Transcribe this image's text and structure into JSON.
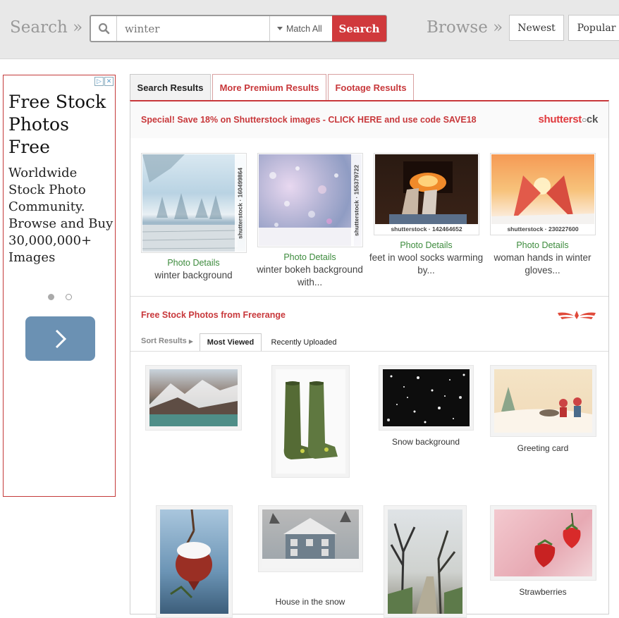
{
  "header": {
    "search_label": "Search »",
    "search_value": "winter",
    "match_label": "Match All",
    "search_button": "Search",
    "browse_label": "Browse »",
    "browse_buttons": [
      "Newest",
      "Popular"
    ]
  },
  "ad": {
    "title": "Free Stock Photos Free",
    "body": "Worldwide Stock Photo Community. Browse and Buy 30,000,000+ Images"
  },
  "tabs": [
    "Search Results",
    "More Premium Results",
    "Footage Results"
  ],
  "promo": {
    "text": "Special! Save 18% on Shutterstock images - CLICK HERE and use code SAVE18",
    "logo_red": "shutterst",
    "logo_gray": "ck"
  },
  "premium": [
    {
      "watermark": "shutterstock · 160499864",
      "details": "Photo Details",
      "desc": "winter background"
    },
    {
      "watermark": "shutterstock · 155379722",
      "details": "Photo Details",
      "desc": "winter bokeh background with..."
    },
    {
      "watermark": "shutterstock · 142464652",
      "details": "Photo Details",
      "desc": "feet in wool socks warming by..."
    },
    {
      "watermark": "shutterstock · 230227600",
      "details": "Photo Details",
      "desc": "woman hands in winter gloves..."
    }
  ],
  "free": {
    "title": "Free Stock Photos from Freerange",
    "sort_label": "Sort Results",
    "sort_tabs": [
      "Most Viewed",
      "Recently Uploaded"
    ],
    "items": [
      {
        "caption": ""
      },
      {
        "caption": ""
      },
      {
        "caption": "Snow background"
      },
      {
        "caption": "Greeting card"
      },
      {
        "caption": ""
      },
      {
        "caption": "House in the snow"
      },
      {
        "caption": ""
      },
      {
        "caption": "Strawberries"
      }
    ]
  }
}
